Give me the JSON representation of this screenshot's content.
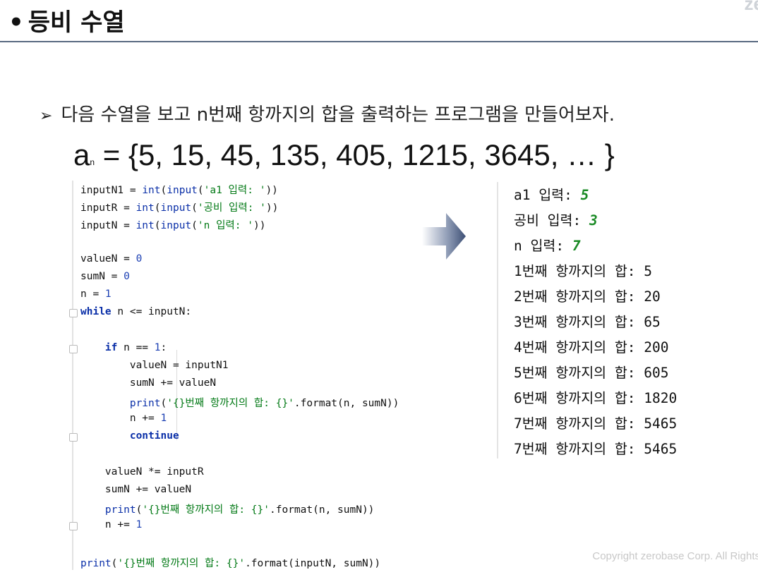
{
  "slide": {
    "title": "등비 수열",
    "title_bullet": "•",
    "logo_text": "ze",
    "instruction_marker": "➢",
    "instruction": "다음 수열을 보고 n번째 항까지의 합을 출력하는 프로그램을 만들어보자.",
    "formula_var": "a",
    "formula_sub": "n",
    "formula_rest": " = {5, 15, 45, 135, 405, 1215, 3645, … }",
    "copyright": "Copyright zerobase Corp. All Rights R"
  },
  "code": {
    "l1": [
      "inputN1 = ",
      "int",
      "(",
      "input",
      "(",
      "'a1 입력: '",
      "))"
    ],
    "l2": [
      "inputR = ",
      "int",
      "(",
      "input",
      "(",
      "'공비 입력: '",
      "))"
    ],
    "l3": [
      "inputN = ",
      "int",
      "(",
      "input",
      "(",
      "'n 입력: '",
      "))"
    ],
    "l4": [
      "valueN = ",
      "0"
    ],
    "l5": [
      "sumN = ",
      "0"
    ],
    "l6": [
      "n = ",
      "1"
    ],
    "l7": [
      "while",
      " n <= inputN:"
    ],
    "l8": [
      "if",
      " n == ",
      "1",
      ":"
    ],
    "l9": "valueN = inputN1",
    "l10": "sumN += valueN",
    "l11": [
      "print",
      "(",
      "'{}번째 항까지의 합: {}'",
      ".format(n, sumN))"
    ],
    "l12": [
      "n += ",
      "1"
    ],
    "l13": "continue",
    "l14": "valueN *= inputR",
    "l15": "sumN += valueN",
    "l16": [
      "print",
      "(",
      "'{}번째 항까지의 합: {}'",
      ".format(n, sumN))"
    ],
    "l17": [
      "n += ",
      "1"
    ],
    "l18": [
      "print",
      "(",
      "'{}번째 항까지의 합: {}'",
      ".format(inputN, sumN))"
    ]
  },
  "console": {
    "prompts": [
      {
        "label": "a1 입력: ",
        "value": "5"
      },
      {
        "label": "공비 입력: ",
        "value": "3"
      },
      {
        "label": "n 입력: ",
        "value": "7"
      }
    ],
    "results": [
      "1번째 항까지의 합: 5",
      "2번째 항까지의 합: 20",
      "3번째 항까지의 합: 65",
      "4번째 항까지의 합: 200",
      "5번째 항까지의 합: 605",
      "6번째 항까지의 합: 1820",
      "7번째 항까지의 합: 5465",
      "7번째 항까지의 합: 5465"
    ]
  },
  "colors": {
    "keyword": "#0a2fa8",
    "string": "#047a17",
    "number": "#1b3fb3",
    "input_value": "#1a8a25",
    "title_rule": "#5a6a82"
  }
}
